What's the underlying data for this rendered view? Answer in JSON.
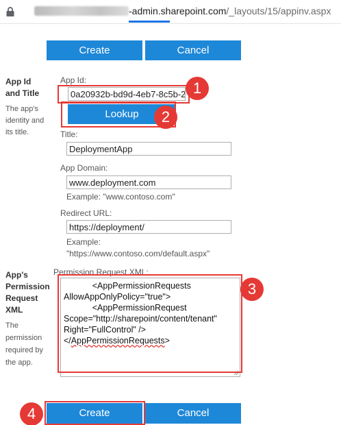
{
  "browser": {
    "url_blurred_prefix": "cmd004dev2tolead",
    "url_host": "-admin.sharepoint.com",
    "url_path": "/_layouts/15/appinv.aspx"
  },
  "toolbar_top": {
    "create_label": "Create",
    "cancel_label": "Cancel"
  },
  "app_section": {
    "title_line1": "App Id",
    "title_line2": "and Title",
    "desc_lines": [
      "The app's",
      "identity and",
      "its title."
    ],
    "app_id_label": "App Id:",
    "app_id_value": "0a20932b-bd9d-4eb7-8c5b-2",
    "lookup_label": "Lookup",
    "title_label": "Title:",
    "title_value": "DeploymentApp",
    "domain_label": "App Domain:",
    "domain_value": "www.deployment.com",
    "domain_example": "Example: \"www.contoso.com\"",
    "redirect_label": "Redirect URL:",
    "redirect_value": "https://deployment/",
    "redirect_example_line1": "Example:",
    "redirect_example_line2": "\"https://www.contoso.com/default.aspx\""
  },
  "permission_section": {
    "title_lines": [
      "App's",
      "Permission",
      "Request",
      "XML"
    ],
    "desc_lines": [
      "The",
      "permission",
      "required by",
      "the app."
    ],
    "xml_label": "Permission Request XML:",
    "xml_line1": "            <AppPermissionRequests",
    "xml_line2": "AllowAppOnlyPolicy=\"true\">",
    "xml_line3": "            <AppPermissionRequest",
    "xml_line4": "Scope=\"http://sharepoint/content/tenant\"",
    "xml_line5": "Right=\"FullControl\" />",
    "xml_line6_pre": "</",
    "xml_line6_sq": "AppPermissionRequests",
    "xml_line6_post": ">"
  },
  "toolbar_bottom": {
    "create_label": "Create",
    "cancel_label": "Cancel"
  },
  "annotations": {
    "step1": "1",
    "step2": "2",
    "step3": "3",
    "step4": "4"
  },
  "colors": {
    "button_blue": "#1e88d8",
    "annotation_red": "#e53935",
    "link_blue": "#1a73e8"
  }
}
